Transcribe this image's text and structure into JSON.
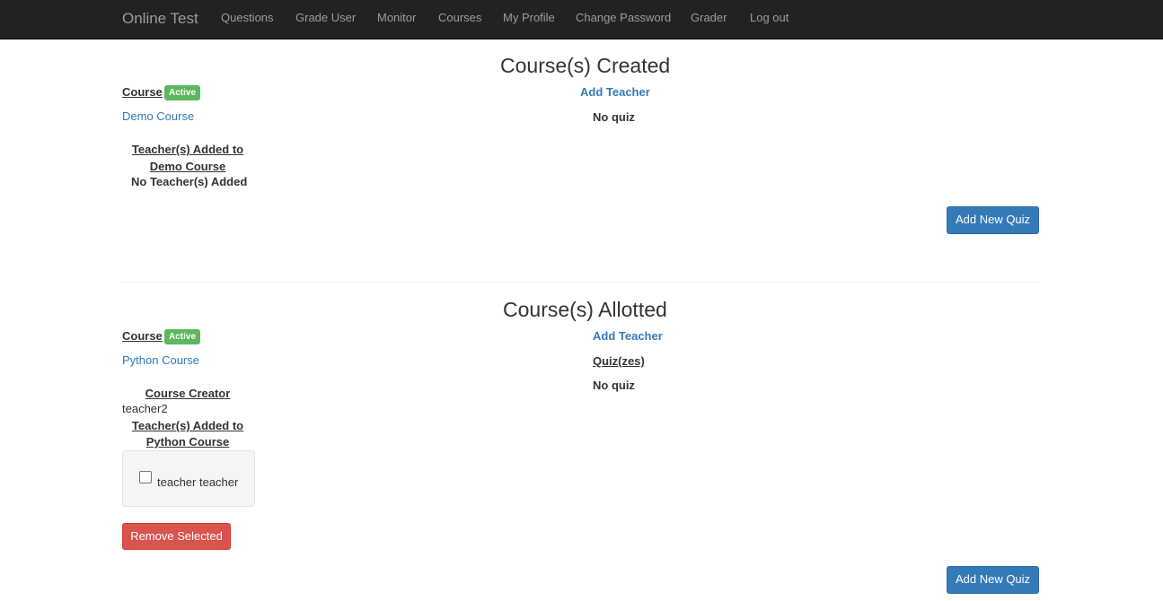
{
  "navbar": {
    "brand": "Online Test",
    "links": [
      "Questions",
      "Grade User",
      "Monitor",
      "Courses",
      "My Profile",
      "Change Password",
      "Grader",
      "Log out"
    ]
  },
  "created": {
    "heading": "Course(s) Created",
    "course_label": "Course",
    "status_badge": "Active",
    "course_name": "Demo Course",
    "add_teacher": "Add Teacher",
    "no_quiz": "No quiz",
    "teachers_heading_line1": "Teacher(s) Added to",
    "teachers_heading_line2": "Demo Course",
    "no_teachers": "No Teacher(s) Added",
    "add_quiz_button": "Add New Quiz"
  },
  "allotted": {
    "heading": "Course(s) Allotted",
    "course_label": "Course",
    "status_badge": "Active",
    "course_name": "Python Course",
    "add_teacher": "Add Teacher",
    "quizzes_heading": "Quiz(zes)",
    "no_quiz": "No quiz",
    "creator_heading": "Course Creator",
    "creator_name": "teacher2",
    "teachers_heading_line1": "Teacher(s) Added to",
    "teachers_heading_line2": "Python Course",
    "teacher_checkbox_label": "teacher teacher",
    "remove_button": "Remove Selected",
    "add_quiz_button": "Add New Quiz"
  },
  "colors": {
    "navbar": "#222222",
    "link": "#337ab7",
    "badge": "#5cb85c",
    "primary": "#337ab7",
    "danger": "#d9534f"
  }
}
